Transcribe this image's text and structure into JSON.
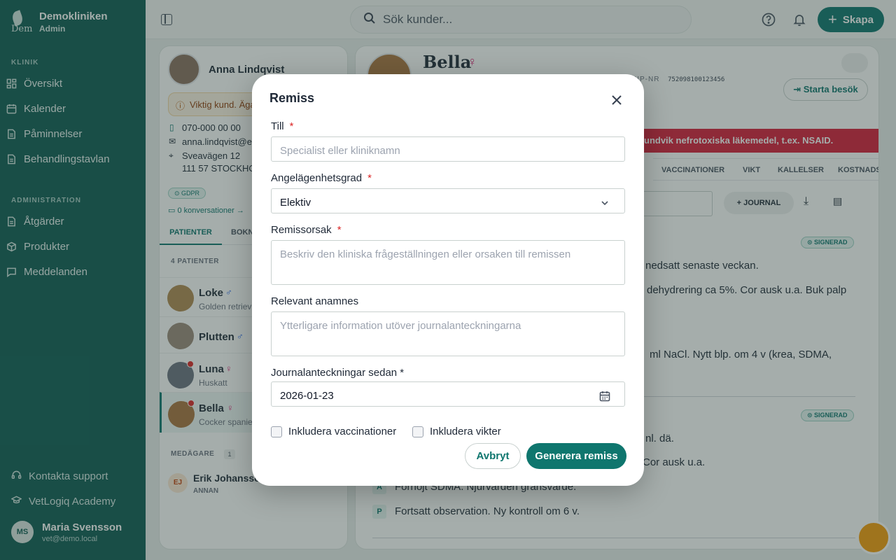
{
  "sidebar": {
    "clinic_name": "Demokliniken",
    "role": "Admin",
    "section_clinic": "KLINIK",
    "section_admin": "ADMINISTRATION",
    "items": [
      {
        "label": "Översikt",
        "icon": "grid-icon"
      },
      {
        "label": "Kalender",
        "icon": "calendar-icon"
      },
      {
        "label": "Påminnelser",
        "icon": "document-icon"
      },
      {
        "label": "Behandlingstavlan",
        "icon": "document-icon"
      },
      {
        "label": "Åtgärder",
        "icon": "document-icon"
      },
      {
        "label": "Produkter",
        "icon": "box-icon"
      },
      {
        "label": "Meddelanden",
        "icon": "chat-icon"
      }
    ],
    "support": "Kontakta support",
    "academy": "VetLogiq Academy",
    "user": {
      "initials": "MS",
      "name": "Maria Svensson",
      "email": "vet@demo.local"
    }
  },
  "topbar": {
    "search_placeholder": "Sök kunder...",
    "create_label": "Skapa"
  },
  "customer": {
    "name": "Anna Lindqvist",
    "alert": "Viktig kund. Äga",
    "phone": "070-000 00 00",
    "email": "anna.lindqvist@ex",
    "street": "Sveavägen 12",
    "city": "111 57 STOCKHOL",
    "gdpr": "GDPR",
    "conversations": "0 konversationer →",
    "tabs": [
      "PATIENTER",
      "BOKN"
    ],
    "patient_count": "4 PATIENTER",
    "patients": [
      {
        "name": "Loke",
        "sex": "♂",
        "breed": "Golden retriev"
      },
      {
        "name": "Plutten",
        "sex": "♂",
        "breed": ""
      },
      {
        "name": "Luna",
        "sex": "♀",
        "breed": "Huskatt"
      },
      {
        "name": "Bella",
        "sex": "♀",
        "breed": "Cocker spanie"
      }
    ],
    "co_owner_label": "MEDÄGARE",
    "co_owner_count": "1",
    "co_owner": {
      "initials": "EJ",
      "name": "Erik Johansso",
      "role": "ANNAN"
    }
  },
  "patient": {
    "name": "Bella",
    "sex": "♀",
    "chip_label": "HIP-NR",
    "chip_number": "752098100123456",
    "start_visit": "Starta besök",
    "warning": "undvik nefrotoxiska läkemedel, t.ex. NSAID.",
    "tabs": [
      "VACCINATIONER",
      "VIKT",
      "KALLELSER",
      "KOSTNADS"
    ],
    "journal_button": "JOURNAL",
    "signed_badge": "SIGNERAD",
    "journal_lines": [
      "nedsatt senaste veckan.",
      "dehydrering ca 5%. Cor ausk u.a. Buk palp",
      "ml NaCl. Nytt blp. om 4 v (krea, SDMA,",
      "nl. dä.",
      "Cor ausk u.a.",
      "Förhöjt SDMA. Njurvärden gränsvärde.",
      "Fortsatt observation. Ny kontroll om 6 v."
    ],
    "soap_a": "A",
    "soap_p": "P"
  },
  "modal": {
    "title": "Remiss",
    "to_label": "Till",
    "to_placeholder": "Specialist eller kliniknamn",
    "urgency_label": "Angelägenhetsgrad",
    "urgency_value": "Elektiv",
    "reason_label": "Remissorsak",
    "reason_placeholder": "Beskriv den kliniska frågeställningen eller orsaken till remissen",
    "anamnesis_label": "Relevant anamnes",
    "anamnesis_placeholder": "Ytterligare information utöver journalanteckningarna",
    "notes_since_label": "Journalanteckningar sedan *",
    "notes_since_value": "2026-01-23",
    "include_vaccinations": "Inkludera vaccinationer",
    "include_weights": "Inkludera vikter",
    "cancel": "Avbryt",
    "generate": "Generera remiss",
    "required_mark": "*"
  },
  "colors": {
    "brand": "#0e5c53",
    "accent": "#0f766e",
    "danger": "#dc2626"
  }
}
